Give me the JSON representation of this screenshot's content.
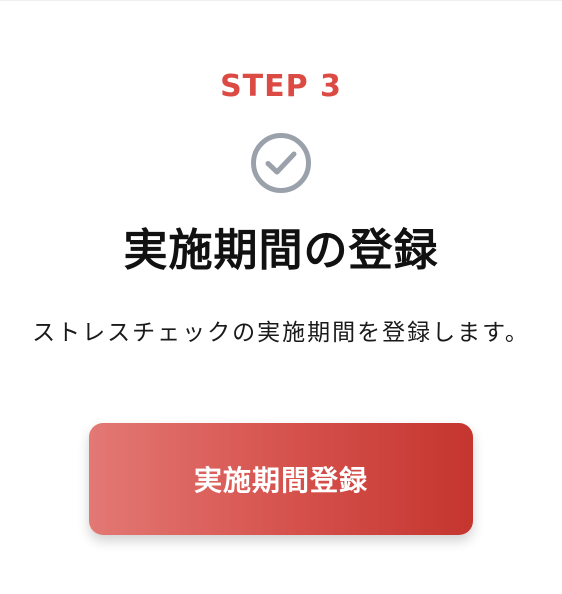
{
  "step": {
    "label": "STEP 3"
  },
  "icons": {
    "status": "check-circle-icon"
  },
  "colors": {
    "accent": "#dc4a44",
    "icon_gray": "#9ba1ab",
    "button_gradient_start": "#e37874",
    "button_gradient_end": "#c4352e"
  },
  "content": {
    "title": "実施期間の登録",
    "description": "ストレスチェックの実施期間を登録します。"
  },
  "actions": {
    "register_label": "実施期間登録"
  }
}
